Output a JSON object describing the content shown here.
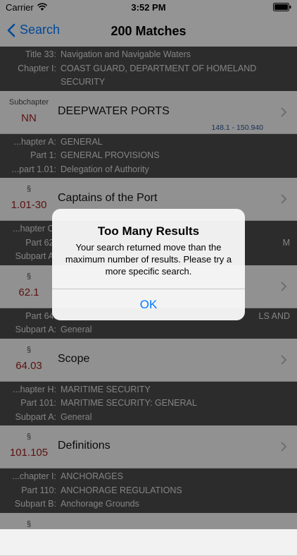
{
  "status": {
    "carrier": "Carrier",
    "time": "3:52 PM"
  },
  "nav": {
    "back_label": "Search",
    "title": "200 Matches"
  },
  "alert": {
    "title": "Too Many Results",
    "message": "Your search returned move than the maximum number of results. Please try a more specific search.",
    "ok": "OK"
  },
  "groups": [
    {
      "header": [
        {
          "label": "Title 33:",
          "value": "Navigation and Navigable Waters"
        },
        {
          "label": "Chapter I:",
          "value": "COAST GUARD, DEPARTMENT OF HOMELAND SECURITY"
        }
      ],
      "cell": {
        "section_label": "Subchapter",
        "number": "NN",
        "name": "DEEPWATER PORTS",
        "range": "148.1 - 150.940"
      }
    },
    {
      "header": [
        {
          "label": "...hapter A:",
          "value": "GENERAL"
        },
        {
          "label": "Part 1:",
          "value": "GENERAL PROVISIONS"
        },
        {
          "label": "...part 1.01:",
          "value": "Delegation of Authority"
        }
      ],
      "cell": {
        "section_label": "§",
        "number": "1.01-30",
        "name": "Captains of the Port",
        "range": ""
      }
    },
    {
      "header": [
        {
          "label": "...hapter C:",
          "value": ""
        },
        {
          "label": "Part 62:",
          "value": "M"
        },
        {
          "label": "Subpart A:",
          "value": ""
        }
      ],
      "cell": {
        "section_label": "§",
        "number": "62.1",
        "name": "",
        "range": ""
      }
    },
    {
      "header": [
        {
          "label": "Part 64:",
          "value": "LS AND"
        },
        {
          "label": "",
          "value": ""
        },
        {
          "label": "Subpart A:",
          "value": "General"
        }
      ],
      "cell": {
        "section_label": "§",
        "number": "64.03",
        "name": "Scope",
        "range": ""
      }
    },
    {
      "header": [
        {
          "label": "...hapter H:",
          "value": "MARITIME SECURITY"
        },
        {
          "label": "Part 101:",
          "value": "MARITIME SECURITY: GENERAL"
        },
        {
          "label": "Subpart A:",
          "value": "General"
        }
      ],
      "cell": {
        "section_label": "§",
        "number": "101.105",
        "name": "Definitions",
        "range": ""
      }
    },
    {
      "header": [
        {
          "label": "...chapter I:",
          "value": "ANCHORAGES"
        },
        {
          "label": "Part 110:",
          "value": "ANCHORAGE REGULATIONS"
        },
        {
          "label": "Subpart B:",
          "value": "Anchorage Grounds"
        }
      ],
      "cell": {
        "section_label": "§",
        "number": "",
        "name": "",
        "range": ""
      }
    }
  ]
}
